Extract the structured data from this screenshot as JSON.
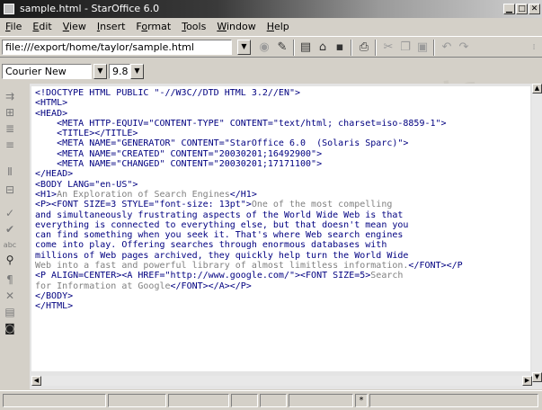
{
  "window": {
    "title": "sample.html - StarOffice 6.0"
  },
  "menubar": {
    "items": [
      "File",
      "Edit",
      "View",
      "Insert",
      "Format",
      "Tools",
      "Window",
      "Help"
    ],
    "mnemonics": [
      "F",
      "E",
      "V",
      "I",
      "o",
      "T",
      "W",
      "H"
    ]
  },
  "address": {
    "value": "file:///export/home/taylor/sample.html"
  },
  "font": {
    "name": "Courier New",
    "size": "9.8"
  },
  "watermark": "Drop Books",
  "document": {
    "lines": [
      [
        {
          "t": "<!DOCTYPE HTML PUBLIC \"-//W3C//DTD HTML 3.2//EN\">",
          "k": "mk"
        }
      ],
      [
        {
          "t": "<HTML>",
          "k": "mk"
        }
      ],
      [
        {
          "t": "<HEAD>",
          "k": "mk"
        }
      ],
      [
        {
          "t": "    <META HTTP-EQUIV=\"CONTENT-TYPE\" CONTENT=\"text/html; charset=iso-8859-1\">",
          "k": "mk"
        }
      ],
      [
        {
          "t": "    <TITLE></TITLE>",
          "k": "mk"
        }
      ],
      [
        {
          "t": "    <META NAME=\"GENERATOR\" CONTENT=\"StarOffice 6.0  (Solaris Sparc)\">",
          "k": "mk"
        }
      ],
      [
        {
          "t": "    <META NAME=\"CREATED\" CONTENT=\"20030201;16492900\">",
          "k": "mk"
        }
      ],
      [
        {
          "t": "    <META NAME=\"CHANGED\" CONTENT=\"20030201;17171100\">",
          "k": "mk"
        }
      ],
      [
        {
          "t": "</HEAD>",
          "k": "mk"
        }
      ],
      [
        {
          "t": "<BODY LANG=\"en-US\">",
          "k": "mk"
        }
      ],
      [
        {
          "t": "<H1>",
          "k": "mk"
        },
        {
          "t": "An Exploration of Search Engines",
          "k": "tx"
        },
        {
          "t": "</H1>",
          "k": "mk"
        }
      ],
      [
        {
          "t": "<P><FONT SIZE=3 STYLE=\"font-size: 13pt\">",
          "k": "mk"
        },
        {
          "t": "One of the most compelling",
          "k": "tx"
        }
      ],
      [
        {
          "t": "and simultaneously frustrating aspects of the World Wide Web is that",
          "k": "mk"
        }
      ],
      [
        {
          "t": "everything is connected to everything else, but that doesn't mean you",
          "k": "mk"
        }
      ],
      [
        {
          "t": "can find something when you seek it. That's where Web search engines",
          "k": "mk"
        }
      ],
      [
        {
          "t": "come into play. Offering searches through enormous databases with",
          "k": "mk"
        }
      ],
      [
        {
          "t": "millions of Web pages archived, they quickly help turn the World Wide",
          "k": "mk"
        }
      ],
      [
        {
          "t": "Web into a fast and powerful library of almost limitless information.",
          "k": "tx"
        },
        {
          "t": "</FONT></P",
          "k": "mk"
        }
      ],
      [
        {
          "t": "<P ALIGN=CENTER><A HREF=\"http://www.google.com/\"><FONT SIZE=5>",
          "k": "mk"
        },
        {
          "t": "Search",
          "k": "tx"
        }
      ],
      [
        {
          "t": "for Information at Google",
          "k": "tx"
        },
        {
          "t": "</FONT></A></P>",
          "k": "mk"
        }
      ],
      [
        {
          "t": "</BODY>",
          "k": "mk"
        }
      ],
      [
        {
          "t": "</HTML>",
          "k": "mk"
        }
      ]
    ]
  },
  "statusbar": {
    "insert_marker": "*"
  },
  "colors": {
    "markup": "#000080",
    "text": "#808080"
  }
}
